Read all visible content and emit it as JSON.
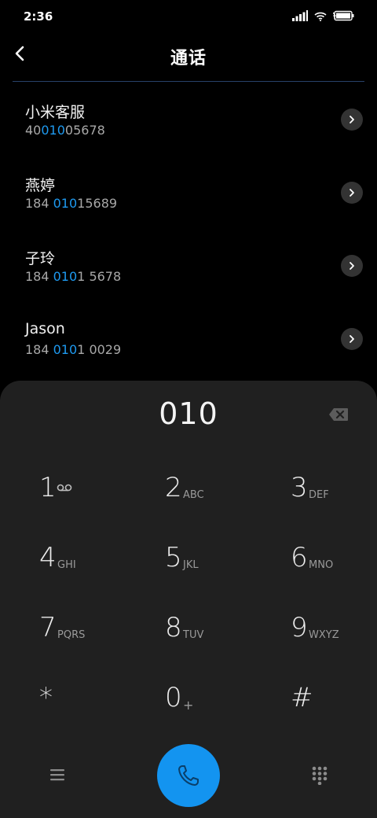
{
  "status_bar": {
    "time": "2:36",
    "icons": [
      "signal-icon",
      "wifi-icon",
      "battery-charging-icon"
    ]
  },
  "header": {
    "title": "通话",
    "back_icon": "chevron-left-icon"
  },
  "contacts": [
    {
      "name": "小米客服",
      "number_prefix": "40",
      "number_highlight": "010",
      "number_suffix": "05678"
    },
    {
      "name": "燕婷",
      "number_prefix": "184 ",
      "number_highlight": "010",
      "number_suffix": "15689"
    },
    {
      "name": "子玲",
      "number_prefix": "184 ",
      "number_highlight": "010",
      "number_suffix": "1 5678"
    },
    {
      "name": "Jason",
      "number_prefix": "184 ",
      "number_highlight": "010",
      "number_suffix": "1 0029"
    }
  ],
  "dialer": {
    "entered": "010",
    "backspace_icon": "backspace-icon"
  },
  "keypad": {
    "keys": [
      {
        "digit": "1",
        "letters": ""
      },
      {
        "digit": "2",
        "letters": "ABC"
      },
      {
        "digit": "3",
        "letters": "DEF"
      },
      {
        "digit": "4",
        "letters": "GHI"
      },
      {
        "digit": "5",
        "letters": "JKL"
      },
      {
        "digit": "6",
        "letters": "MNO"
      },
      {
        "digit": "7",
        "letters": "PQRS"
      },
      {
        "digit": "8",
        "letters": "TUV"
      },
      {
        "digit": "9",
        "letters": "WXYZ"
      },
      {
        "digit": "*",
        "letters": ""
      },
      {
        "digit": "0",
        "letters": "+"
      },
      {
        "digit": "#",
        "letters": ""
      }
    ]
  },
  "bottom_bar": {
    "menu_icon": "menu-icon",
    "call_icon": "phone-icon",
    "keypad_icon": "dialpad-icon"
  },
  "colors": {
    "background": "#000000",
    "dialer_panel": "#202020",
    "highlight": "#1e9af0",
    "call_button": "#1394f0"
  }
}
